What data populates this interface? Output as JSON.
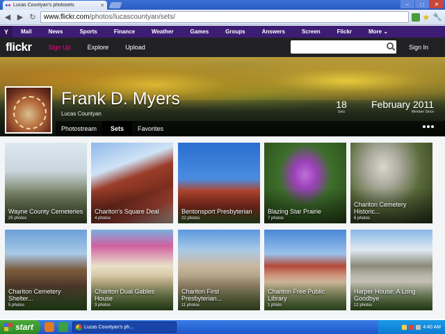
{
  "browser": {
    "tab_title": "Lucas Countyan's photosets",
    "url_domain": "www.flickr.com",
    "url_path": "/photos/lucascountyan/sets/"
  },
  "yahoo_bar": {
    "items": [
      "Mail",
      "News",
      "Sports",
      "Finance",
      "Weather",
      "Games",
      "Groups",
      "Answers",
      "Screen",
      "Flickr",
      "More ⌄"
    ]
  },
  "flickr_header": {
    "logo": "flickr",
    "nav": [
      "Sign Up",
      "Explore",
      "Upload"
    ],
    "signin": "Sign In"
  },
  "profile": {
    "name": "Frank D. Myers",
    "username": "Lucas Countyan",
    "sets_count": "18",
    "sets_label": "Sets",
    "member_since": "February 2011",
    "member_label": "Member Since"
  },
  "subnav": [
    "Photostream",
    "Sets",
    "Favorites"
  ],
  "sets": [
    {
      "title": "Wayne County Cemeteries",
      "count": "25 photos"
    },
    {
      "title": "Chariton's Square Deal",
      "count": "4 photos"
    },
    {
      "title": "Bentonsport Presbyterian",
      "count": "22 photos"
    },
    {
      "title": "Blazing Star Prairie",
      "count": "7 photos"
    },
    {
      "title": "Chariton Cemetery Historic...",
      "count": "6 photos"
    },
    {
      "title": "Chariton Cemetery Shelter...",
      "count": "5 photos"
    },
    {
      "title": "Chariton Dual Gables House",
      "count": "3 photos"
    },
    {
      "title": "Chariton First Presbyterian...",
      "count": "11 photos"
    },
    {
      "title": "Chariton Free Public Library",
      "count": "1 photo"
    },
    {
      "title": "Harper House: A Long Goodbye",
      "count": "12 photos"
    }
  ],
  "taskbar": {
    "start": "start",
    "task": "Lucas Countyan's ph...",
    "clock": "4:40 AM"
  },
  "colors": {
    "yahoo_purple": "#3c1d73",
    "flickr_dark": "#212124",
    "flickr_pink": "#ff0084"
  }
}
